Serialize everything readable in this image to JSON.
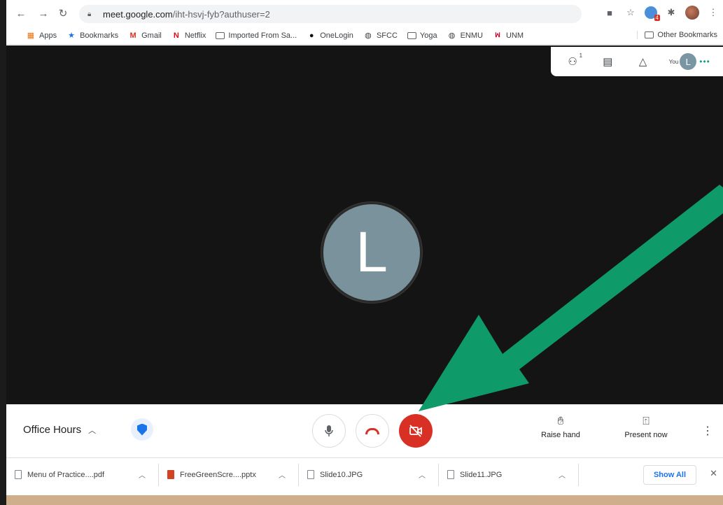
{
  "browser": {
    "url_host": "meet.google.com",
    "url_path": "/iht-hsvj-fyb?authuser=2",
    "extension_badge": "4"
  },
  "bookmarks": {
    "items": [
      {
        "label": "Apps",
        "icon": "apps-grid-icon"
      },
      {
        "label": "Bookmarks",
        "icon": "star-icon"
      },
      {
        "label": "Gmail",
        "icon": "gmail-icon"
      },
      {
        "label": "Netflix",
        "icon": "netflix-icon"
      },
      {
        "label": "Imported From Sa...",
        "icon": "folder-icon"
      },
      {
        "label": "OneLogin",
        "icon": "onelogin-icon"
      },
      {
        "label": "SFCC",
        "icon": "globe-icon"
      },
      {
        "label": "Yoga",
        "icon": "folder-icon"
      },
      {
        "label": "ENMU",
        "icon": "globe-icon"
      },
      {
        "label": "UNM",
        "icon": "unm-icon"
      }
    ],
    "other": "Other Bookmarks"
  },
  "meet": {
    "participant_count": "1",
    "you_label": "You",
    "avatar_letter": "L",
    "center_letter": "L",
    "meeting_title": "Office Hours",
    "raise_hand": "Raise hand",
    "present_now": "Present now"
  },
  "downloads": {
    "items": [
      {
        "name": "Menu of Practice....pdf",
        "type": "file"
      },
      {
        "name": "FreeGreenScre....pptx",
        "type": "ppt"
      },
      {
        "name": "Slide10.JPG",
        "type": "file"
      },
      {
        "name": "Slide11.JPG",
        "type": "file"
      }
    ],
    "show_all": "Show All"
  },
  "colors": {
    "accent_blue": "#1a73e8",
    "hangup_red": "#d93025",
    "arrow_green": "#0f9a6a",
    "meet_bg": "#141414"
  }
}
